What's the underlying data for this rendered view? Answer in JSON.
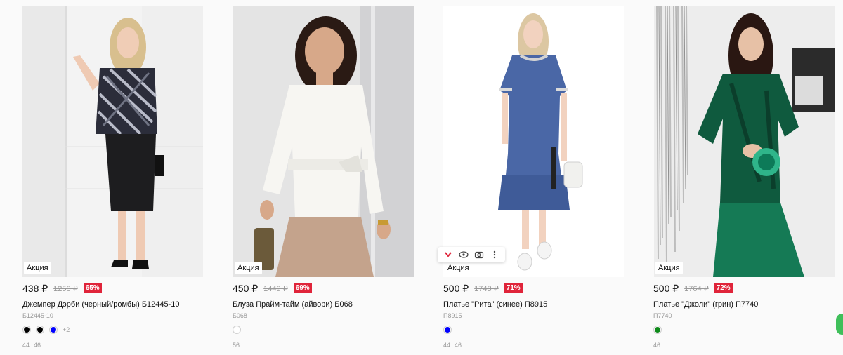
{
  "products": [
    {
      "badge": "Акция",
      "price": "438 ₽",
      "old_price": "1250 ₽",
      "discount": "65%",
      "name": "Джемпер Дэрби (черный/ромбы) Б12445-10",
      "sku": "Б12445-10",
      "colors": [
        "#000000",
        "#000000",
        "#0000ff"
      ],
      "more_colors": "+2",
      "sizes": [
        "44",
        "46"
      ]
    },
    {
      "badge": "Акция",
      "price": "450 ₽",
      "old_price": "1449 ₽",
      "discount": "69%",
      "name": "Блуза Прайм-тайм (айвори) Б068",
      "sku": "Б068",
      "colors": [
        "#ffffff"
      ],
      "sizes": [
        "56"
      ]
    },
    {
      "badge": "Акция",
      "price": "500 ₽",
      "old_price": "1748 ₽",
      "discount": "71%",
      "name": "Платье \"Рита\" (синее) П8915",
      "sku": "П8915",
      "colors": [
        "#0000ff"
      ],
      "sizes": [
        "44",
        "46"
      ],
      "hover_icons": [
        "chevron-down-icon",
        "eye-icon",
        "camera-icon",
        "more-vertical-icon"
      ]
    },
    {
      "badge": "Акция",
      "price": "500 ₽",
      "old_price": "1764 ₽",
      "discount": "72%",
      "name": "Платье \"Джоли\" (грин) П7740",
      "sku": "П7740",
      "colors": [
        "#0e8a1a"
      ],
      "sizes": [
        "46"
      ]
    }
  ],
  "accent": {
    "discount": "#e0243a",
    "widget": "#3fbf5a"
  }
}
